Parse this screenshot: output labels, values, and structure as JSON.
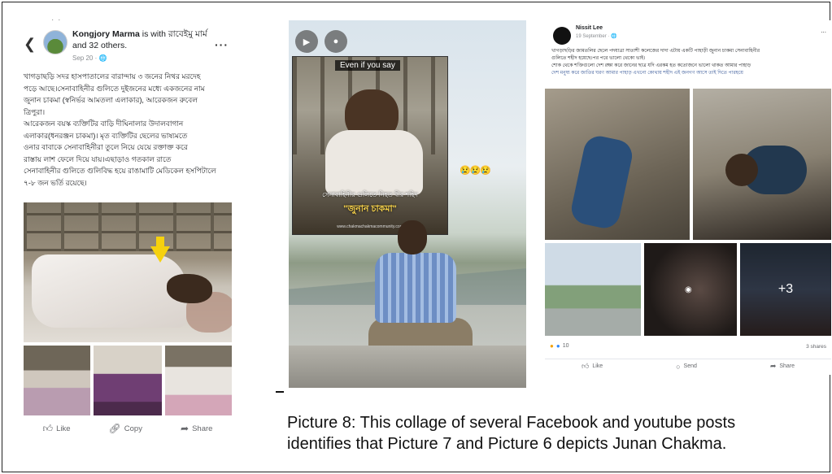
{
  "left_post": {
    "author_name": "Kongjory Marma",
    "author_rest": " is with রাবেইমু মার্ম and 32 others.",
    "date": "Sep 20 · 🌐",
    "text_lines": [
      "খাগড়াছড়ি সদর হাসপাতালের বারান্দায় ৩ জনের নিথর মরদেহ",
      "পড়ে আছে।সেনাবাহিনীর গুলিতে দুইজনের মধ্যে একজনের নাম",
      "জুনান চাকমা (স্বনির্ভর আমতলা এলাকার), আরেকজন রুবেল",
      "ত্রিপুরা।",
      "আরেকজন বয়স্ক ব্যক্তিটির বাড়ি দীঘিনালার উদালবাগান",
      "এলাকার(ধনরঞ্জন চাকমা)। মৃত ব্যক্তিটির ছেলের ভাষ্যমতে",
      "ওনার বাবাকে সেনাবাহিনীরা তুলে নিয়ে যেয়ে রক্তাক্ত করে",
      "রাস্তায় লাশ ফেলে দিয়ে যায়।এছাড়াও গতকাল রাতে",
      "সেনাবাহিনীর গুলিতে গুলিবিদ্ধ হয়ে রাঙামাটি মেডিকেল হসপিটালে",
      "৭-৮ জন ভর্তি রয়েছে।"
    ],
    "actions": {
      "like": "Like",
      "copy": "Copy",
      "share": "Share"
    }
  },
  "middle_video": {
    "inset_top_text": "Even if you say",
    "inset_caption_small": "সেনাবাহিনীর গুলিতে নিহত বীর শহিদ",
    "inset_caption_name": "\"জুনান চাকমা\"",
    "inset_url": "www.chakmachakmacommunity.com",
    "emoji": "😢😢😢"
  },
  "right_post": {
    "author_name": "Nissit Lee",
    "date": "19 September · 🌐",
    "text_lines": [
      "খাগড়াছড়ির জামতলির ছেলে পদযাত্রা সাতাশী কলেজের দাদা এটায় একটি পাহাড়ী জুনান চাকমা সেনাবাহিনীর",
      "গুলিতে শহীদ হয়েছে।পর পরে ভালো থেকো ভাই।",
      "শোক থেকে শক্তিগুলো দেশ রক্ষা করে জানের ছাত্র যদি এরকম হত কতোজনে ভালো থাকত আমার পাহাড়",
      "দেশ মনুষ্য করে জাতির ঘরণ আমার পাহাড় এখনো কোথায় শহীদ এই জনগণ আসে তাই দিতে পারহয়ে"
    ],
    "hidden_text": "...",
    "more_count": "+3",
    "reaction_count": "10",
    "shares": "3 shares",
    "actions": {
      "like": "Like",
      "send": "Send",
      "share": "Share"
    }
  },
  "caption": {
    "line1": "Picture 8: This collage of several Facebook and youtube posts",
    "line2": "identifies that Picture 7 and Picture 6 depicts Junan Chakma."
  }
}
